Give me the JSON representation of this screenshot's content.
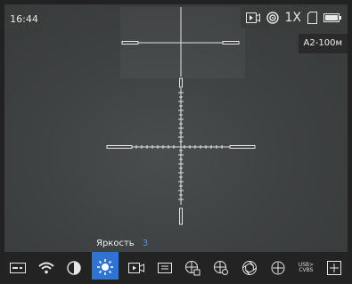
{
  "status": {
    "time": "16:44",
    "zoom": "1X"
  },
  "profile": "A2-100м",
  "brightness": {
    "label": "Яркость",
    "value": "3"
  },
  "toolbar": {
    "items": [
      {
        "id": "image-mode",
        "icon": "image-mode-icon"
      },
      {
        "id": "wifi",
        "icon": "wifi-icon"
      },
      {
        "id": "contrast",
        "icon": "contrast-icon"
      },
      {
        "id": "brightness",
        "icon": "sun-icon",
        "active": true
      },
      {
        "id": "video",
        "icon": "video-record-icon"
      },
      {
        "id": "display",
        "icon": "display-icon"
      },
      {
        "id": "zeroing",
        "icon": "zeroing-icon"
      },
      {
        "id": "calibration",
        "icon": "calibration-icon"
      },
      {
        "id": "shutter",
        "icon": "aperture-icon"
      },
      {
        "id": "reticle",
        "icon": "reticle-icon"
      },
      {
        "id": "cvbs",
        "icon": "usb-cvbs-icon",
        "label": "USB>\nCVBS"
      },
      {
        "id": "more",
        "icon": "plus-box-icon"
      }
    ]
  },
  "colors": {
    "accent": "#2f73d6",
    "value_text": "#4a90e2"
  }
}
